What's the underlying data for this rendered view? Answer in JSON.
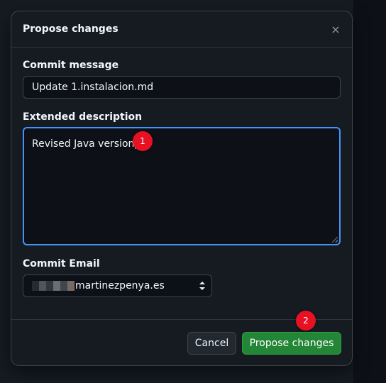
{
  "dialog": {
    "title": "Propose changes",
    "close_icon": "×"
  },
  "commit_message": {
    "label": "Commit message",
    "value": "Update 1.instalacion.md"
  },
  "extended_description": {
    "label": "Extended description",
    "value": "Revised Java version"
  },
  "commit_email": {
    "label": "Commit Email",
    "selected": "martinezpenya.es"
  },
  "footer": {
    "cancel_label": "Cancel",
    "submit_label": "Propose changes"
  },
  "annotations": [
    {
      "label": "1"
    },
    {
      "label": "2"
    }
  ],
  "colors": {
    "accent_focus": "#4493f8",
    "primary_button": "#238636",
    "annotation_marker": "#e81123"
  }
}
